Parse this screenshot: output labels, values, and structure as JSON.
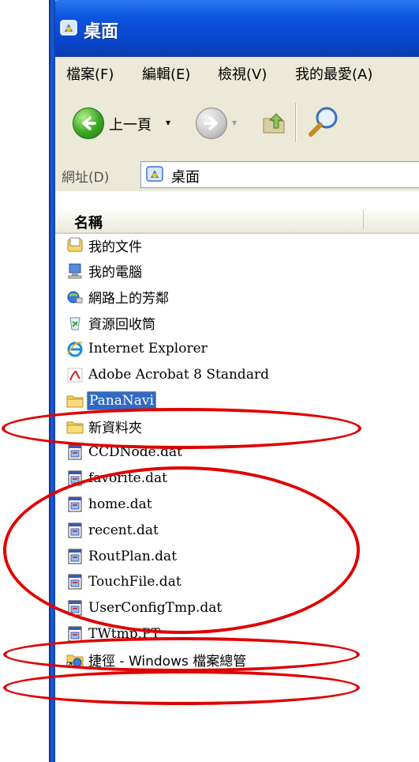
{
  "window": {
    "title": "桌面"
  },
  "menu": [
    "檔案(F)",
    "編輯(E)",
    "檢視(V)",
    "我的最愛(A)"
  ],
  "toolbar": {
    "back_label": "上一頁",
    "back_dropdown": "▾",
    "forward_dropdown": "▾"
  },
  "address": {
    "label": "網址(D)",
    "value": "桌面"
  },
  "list": {
    "column_name": "名稱",
    "items": [
      {
        "name": "我的文件",
        "icon": "my-documents-icon",
        "selected": false
      },
      {
        "name": "我的電腦",
        "icon": "my-computer-icon",
        "selected": false
      },
      {
        "name": "網路上的芳鄰",
        "icon": "network-places-icon",
        "selected": false
      },
      {
        "name": "資源回收筒",
        "icon": "recycle-bin-icon",
        "selected": false
      },
      {
        "name": "Internet Explorer",
        "icon": "internet-explorer-icon",
        "selected": false
      },
      {
        "name": "Adobe Acrobat 8 Standard",
        "icon": "acrobat-icon",
        "selected": false
      },
      {
        "name": "PanaNavi",
        "icon": "folder-icon",
        "selected": true
      },
      {
        "name": "新資料夾",
        "icon": "folder-icon",
        "selected": false
      },
      {
        "name": "CCDNode.dat",
        "icon": "dat-file-icon",
        "selected": false
      },
      {
        "name": "favorite.dat",
        "icon": "dat-file-icon",
        "selected": false
      },
      {
        "name": "home.dat",
        "icon": "dat-file-icon",
        "selected": false
      },
      {
        "name": "recent.dat",
        "icon": "dat-file-icon",
        "selected": false
      },
      {
        "name": "RoutPlan.dat",
        "icon": "dat-file-icon",
        "selected": false
      },
      {
        "name": "TouchFile.dat",
        "icon": "dat-file-icon",
        "selected": false
      },
      {
        "name": "UserConfigTmp.dat",
        "icon": "dat-file-icon",
        "selected": false
      },
      {
        "name": "TWtmp.PT",
        "icon": "dat-file-icon",
        "selected": false
      },
      {
        "name": "捷徑 - Windows 檔案總管",
        "icon": "explorer-shortcut-icon",
        "selected": false
      }
    ]
  },
  "colors": {
    "title_bar": "#0846cc",
    "selection": "#316ac5",
    "annotation": "#e00000"
  }
}
